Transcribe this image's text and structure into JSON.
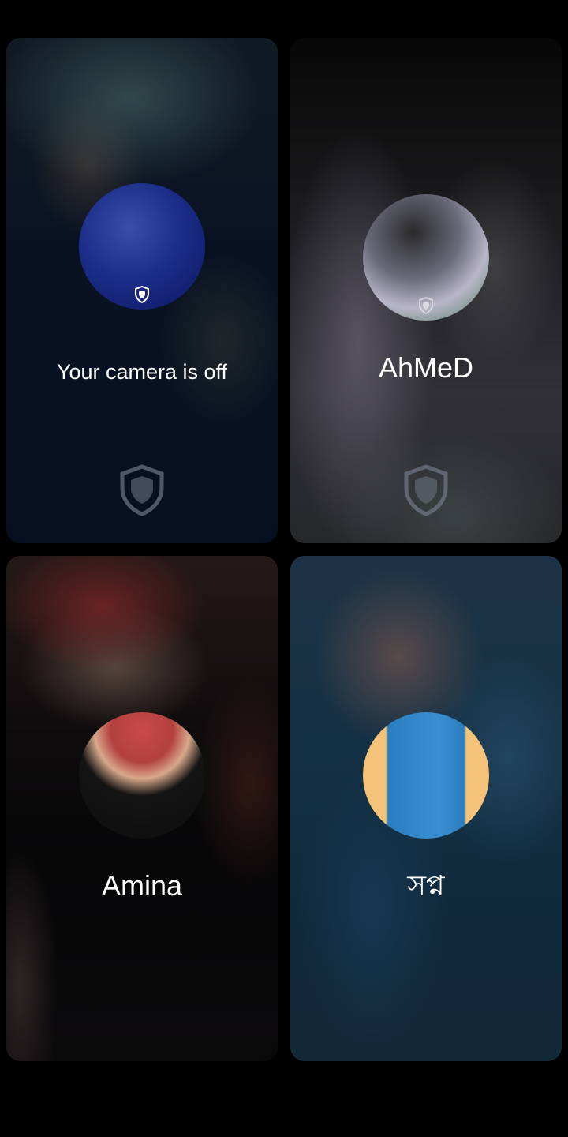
{
  "participants": [
    {
      "name": "Your camera is off",
      "is_self": true,
      "avatar": "user-avatar",
      "shield_icon": "shield-icon"
    },
    {
      "name": "AhMeD",
      "is_self": false,
      "avatar": "user-avatar",
      "shield_icon": "shield-icon"
    },
    {
      "name": "Amina",
      "is_self": false,
      "avatar": "user-avatar"
    },
    {
      "name": "সপ্ন",
      "is_self": false,
      "avatar": "user-avatar"
    }
  ],
  "colors": {
    "background": "#000000",
    "text": "#ffffff",
    "shield_outline": "#8a94a6"
  }
}
